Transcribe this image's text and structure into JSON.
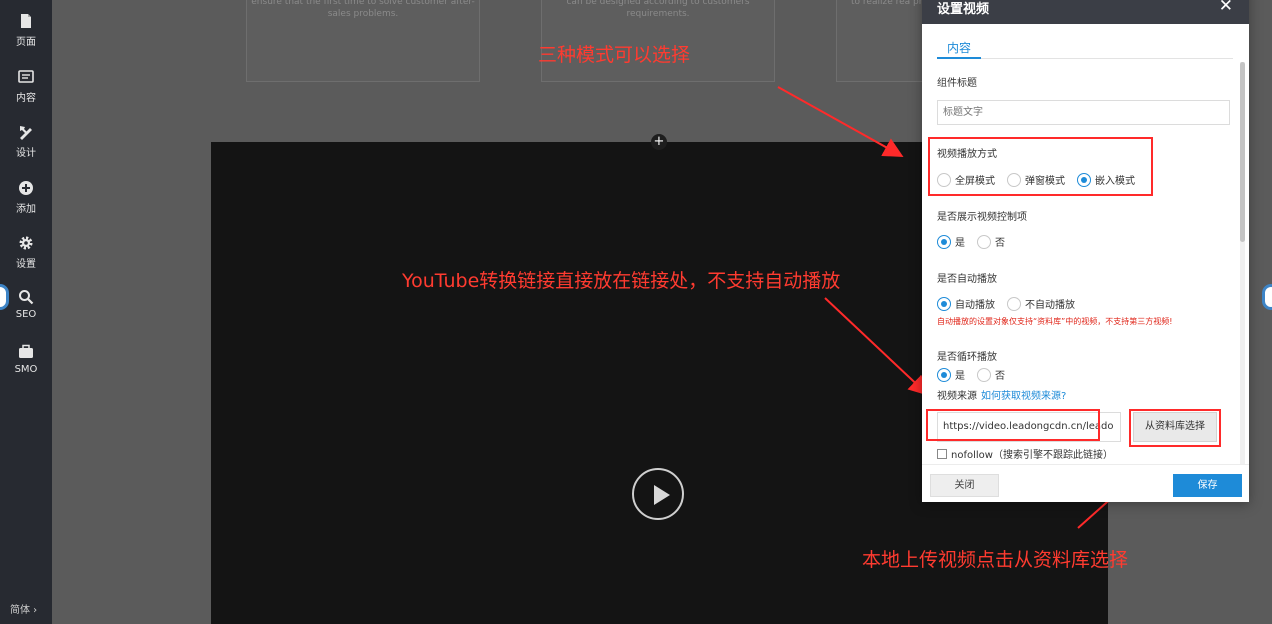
{
  "sidebar": {
    "items": [
      {
        "label": "页面",
        "icon": "page-icon"
      },
      {
        "label": "内容",
        "icon": "content-icon"
      },
      {
        "label": "设计",
        "icon": "design-icon"
      },
      {
        "label": "添加",
        "icon": "add-icon"
      },
      {
        "label": "设置",
        "icon": "settings-icon"
      },
      {
        "label": "SEO",
        "icon": "search-icon"
      },
      {
        "label": "SMO",
        "icon": "briefcase-icon"
      }
    ],
    "language": "简体 ›"
  },
  "canvas": {
    "cards": [
      {
        "text": "ensure that the first time to solve customer after-sales problems."
      },
      {
        "text": "can be designed according to customers requirements."
      },
      {
        "text": "to realize rea provide v"
      }
    ],
    "add_symbol": "+"
  },
  "annotations": {
    "modes_note": "三种模式可以选择",
    "youtube_note": "YouTube转换链接直接放在链接处，不支持自动播放",
    "upload_note": "本地上传视频点击从资料库选择"
  },
  "dialog": {
    "title": "设置视频",
    "close_symbol": "✕",
    "tab": "内容",
    "component_title_label": "组件标题",
    "component_title_placeholder": "标题文字",
    "play_mode_label": "视频播放方式",
    "play_modes": [
      {
        "label": "全屏模式",
        "selected": false
      },
      {
        "label": "弹窗模式",
        "selected": false
      },
      {
        "label": "嵌入模式",
        "selected": true
      }
    ],
    "controls_label": "是否展示视频控制项",
    "controls_options": [
      {
        "label": "是",
        "selected": true
      },
      {
        "label": "否",
        "selected": false
      }
    ],
    "autoplay_label": "是否自动播放",
    "autoplay_options": [
      {
        "label": "自动播放",
        "selected": true
      },
      {
        "label": "不自动播放",
        "selected": false
      }
    ],
    "autoplay_warning": "自动播放的设置对象仅支持“资料库”中的视频，不支持第三方视频!",
    "loop_label": "是否循环播放",
    "loop_options": [
      {
        "label": "是",
        "selected": true
      },
      {
        "label": "否",
        "selected": false
      }
    ],
    "source_label": "视频来源",
    "source_help": "如何获取视频来源?",
    "source_url": "https://video.leadongcdn.cn/leado",
    "library_button": "从资料库选择",
    "nofollow_label": "nofollow（搜索引擎不跟踪此链接）",
    "close_button": "关闭",
    "save_button": "保存"
  },
  "colors": {
    "accent": "#1e8bd8",
    "annotation": "#ff3b30",
    "sidebar_bg": "#272a31",
    "dialog_header": "#3b3e46"
  }
}
